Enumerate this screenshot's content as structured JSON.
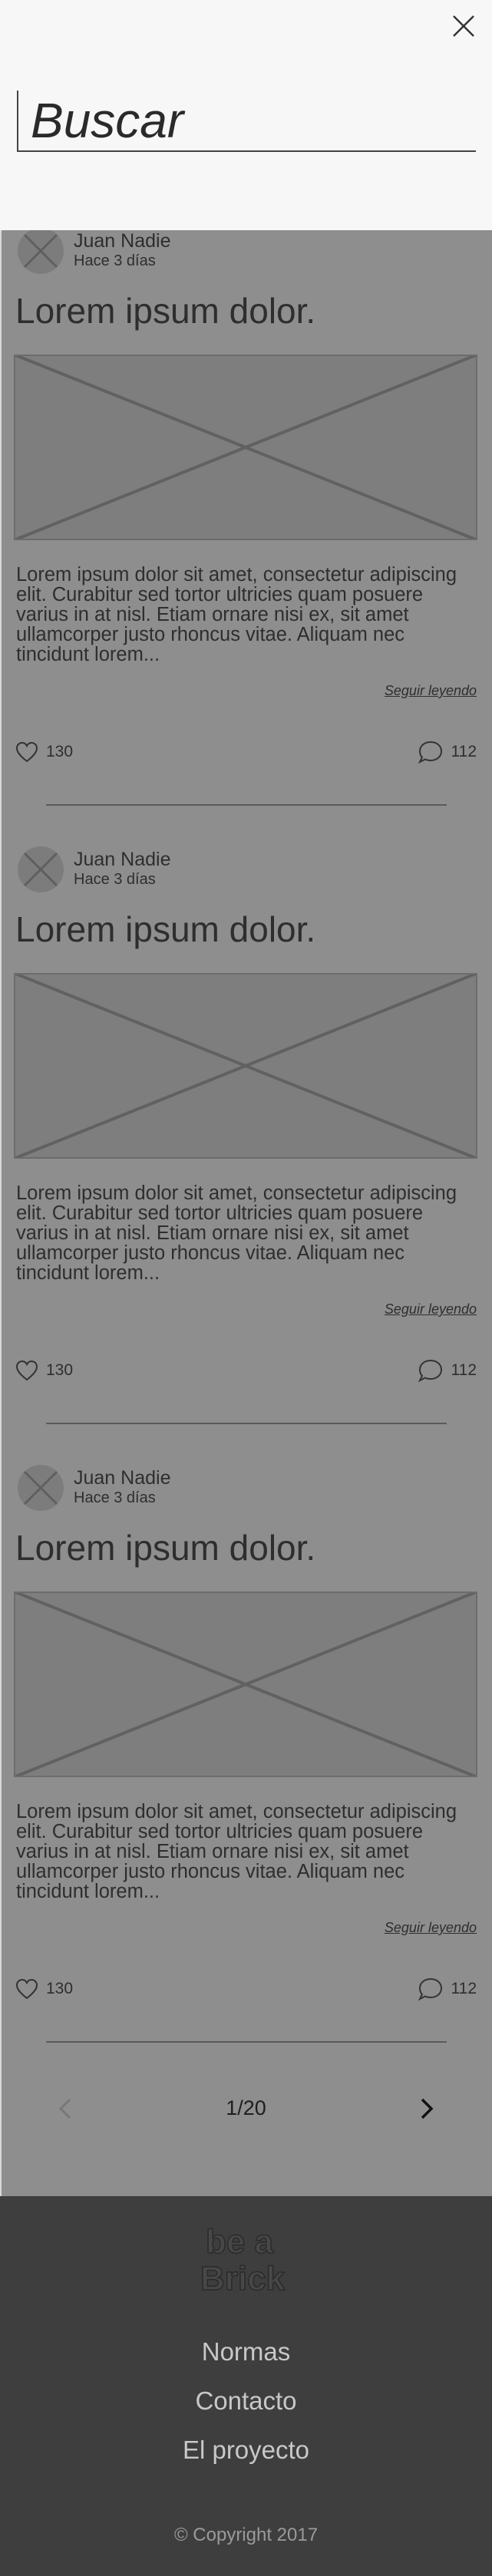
{
  "search": {
    "placeholder": "Buscar",
    "close_icon": "close-icon"
  },
  "posts": [
    {
      "author": "Juan Nadie",
      "time": "Hace 3 días",
      "title": "Lorem ipsum dolor.",
      "excerpt_lines": [
        "Lorem ipsum dolor sit amet, consectetur adipiscing",
        "elit. Curabitur sed tortor ultricies quam posuere",
        "varius in at nisl. Etiam ornare nisi ex, sit amet",
        "ullamcorper justo rhoncus vitae. Aliquam nec",
        "tincidunt lorem..."
      ],
      "read_more": "Seguir leyendo",
      "likes": "130",
      "comments": "112"
    },
    {
      "author": "Juan Nadie",
      "time": "Hace 3 días",
      "title": "Lorem ipsum dolor.",
      "excerpt_lines": [
        "Lorem ipsum dolor sit amet, consectetur adipiscing",
        "elit. Curabitur sed tortor ultricies quam posuere",
        "varius in at nisl. Etiam ornare nisi ex, sit amet",
        "ullamcorper justo rhoncus vitae. Aliquam nec",
        "tincidunt lorem..."
      ],
      "read_more": "Seguir leyendo",
      "likes": "130",
      "comments": "112"
    },
    {
      "author": "Juan Nadie",
      "time": "Hace 3 días",
      "title": "Lorem ipsum dolor.",
      "excerpt_lines": [
        "Lorem ipsum dolor sit amet, consectetur adipiscing",
        "elit. Curabitur sed tortor ultricies quam posuere",
        "varius in at nisl. Etiam ornare nisi ex, sit amet",
        "ullamcorper justo rhoncus vitae. Aliquam nec",
        "tincidunt lorem..."
      ],
      "read_more": "Seguir leyendo",
      "likes": "130",
      "comments": "112"
    }
  ],
  "pagination": {
    "label": "1/20",
    "prev_icon": "chevron-left-icon",
    "next_icon": "chevron-right-icon"
  },
  "footer": {
    "logo_line1": "be a",
    "logo_line2": "Brick",
    "links": [
      "Normas",
      "Contacto",
      "El proyecto"
    ],
    "copyright": "© Copyright 2017"
  },
  "colors": {
    "overlay_dim": "#8e8e8e",
    "search_panel": "#f7f7f7",
    "footer_bg": "#3e3e3e",
    "footer_link": "#c8c8c8"
  }
}
